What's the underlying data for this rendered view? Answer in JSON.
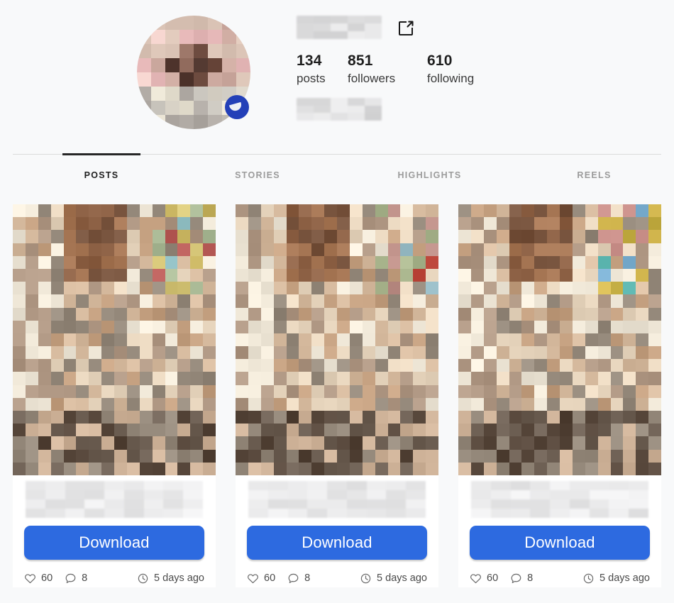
{
  "profile": {
    "avatar_name": "profile-avatar-pixelated",
    "username_blurred": true,
    "bio_blurred": true,
    "external_link_icon": "external-link-icon",
    "stats": [
      {
        "value": "134",
        "label": "posts"
      },
      {
        "value": "851",
        "label": "followers"
      },
      {
        "value": "610",
        "label": "following"
      }
    ]
  },
  "tabs": [
    {
      "label": "POSTS",
      "active": true
    },
    {
      "label": "STORIES",
      "active": false
    },
    {
      "label": "HIGHLIGHTS",
      "active": false
    },
    {
      "label": "REELS",
      "active": false
    }
  ],
  "posts": [
    {
      "image": "post-thumbnail-pixelated",
      "caption_blurred": true,
      "download_label": "Download",
      "likes": "60",
      "comments": "8",
      "time": "5 days ago"
    },
    {
      "image": "post-thumbnail-pixelated",
      "caption_blurred": true,
      "download_label": "Download",
      "likes": "60",
      "comments": "8",
      "time": "5 days ago"
    },
    {
      "image": "post-thumbnail-pixelated",
      "caption_blurred": true,
      "download_label": "Download",
      "likes": "60",
      "comments": "8",
      "time": "5 days ago"
    }
  ],
  "icons": {
    "like": "heart-icon",
    "comment": "comment-bubble-icon",
    "time": "clock-icon"
  },
  "colors": {
    "download_button": "#2d6ae0",
    "page_background": "#f8f9fa",
    "card_background": "#ffffff",
    "active_tab": "#262626",
    "inactive_tab": "#9b9b9b",
    "badge_blue": "#2340b8"
  }
}
